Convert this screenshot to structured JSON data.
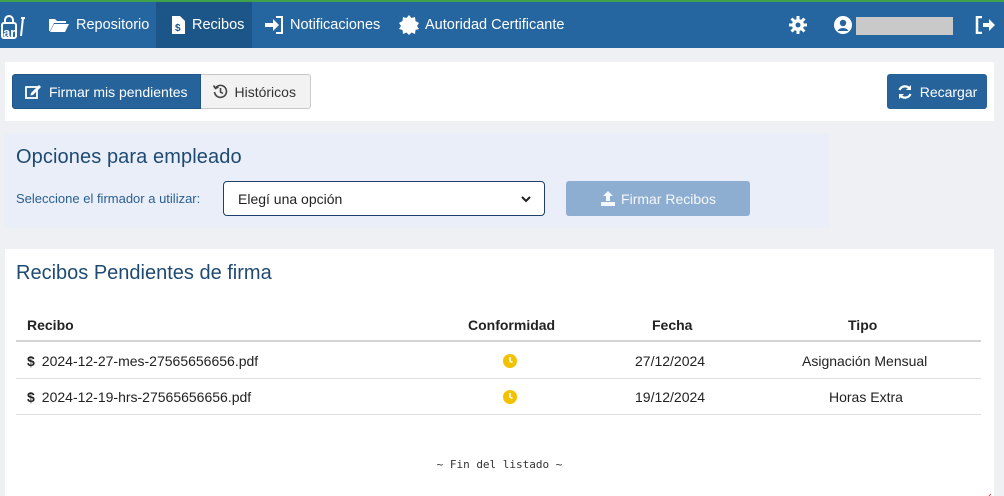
{
  "nav": {
    "logo_text": "ar",
    "items": [
      {
        "label": "Repositorio",
        "icon": "folder-open-icon"
      },
      {
        "label": "Recibos",
        "icon": "receipt-icon",
        "active": true
      },
      {
        "label": "Notificaciones",
        "icon": "sign-in-icon"
      },
      {
        "label": "Autoridad Certificante",
        "icon": "certificate-icon"
      }
    ],
    "settings_icon": "gear-icon",
    "user_icon": "user-circle-icon",
    "logout_icon": "sign-out-icon",
    "colors": {
      "navbar": "#2565a0",
      "active": "#1c5688",
      "accent_top": "#3fa24a"
    }
  },
  "toolbar": {
    "tab_pending": "Firmar mis pendientes",
    "tab_history": "Históricos",
    "reload": "Recargar"
  },
  "options": {
    "title": "Opciones para empleado",
    "signer_label": "Seleccione el firmador a utilizar:",
    "signer_select_value": "Elegí una opción",
    "sign_button": "Firmar Recibos"
  },
  "list": {
    "title": "Recibos Pendientes de firma",
    "columns": [
      "Recibo",
      "Conformidad",
      "Fecha",
      "Tipo"
    ],
    "rows": [
      {
        "file": "2024-12-27-mes-27565656656.pdf",
        "conformity_icon": "clock-icon",
        "date": "27/12/2024",
        "type": "Asignación Mensual"
      },
      {
        "file": "2024-12-19-hrs-27565656656.pdf",
        "conformity_icon": "clock-icon",
        "date": "19/12/2024",
        "type": "Horas Extra"
      }
    ],
    "currency_symbol": "$",
    "end_note": "~ Fin del listado ~"
  }
}
